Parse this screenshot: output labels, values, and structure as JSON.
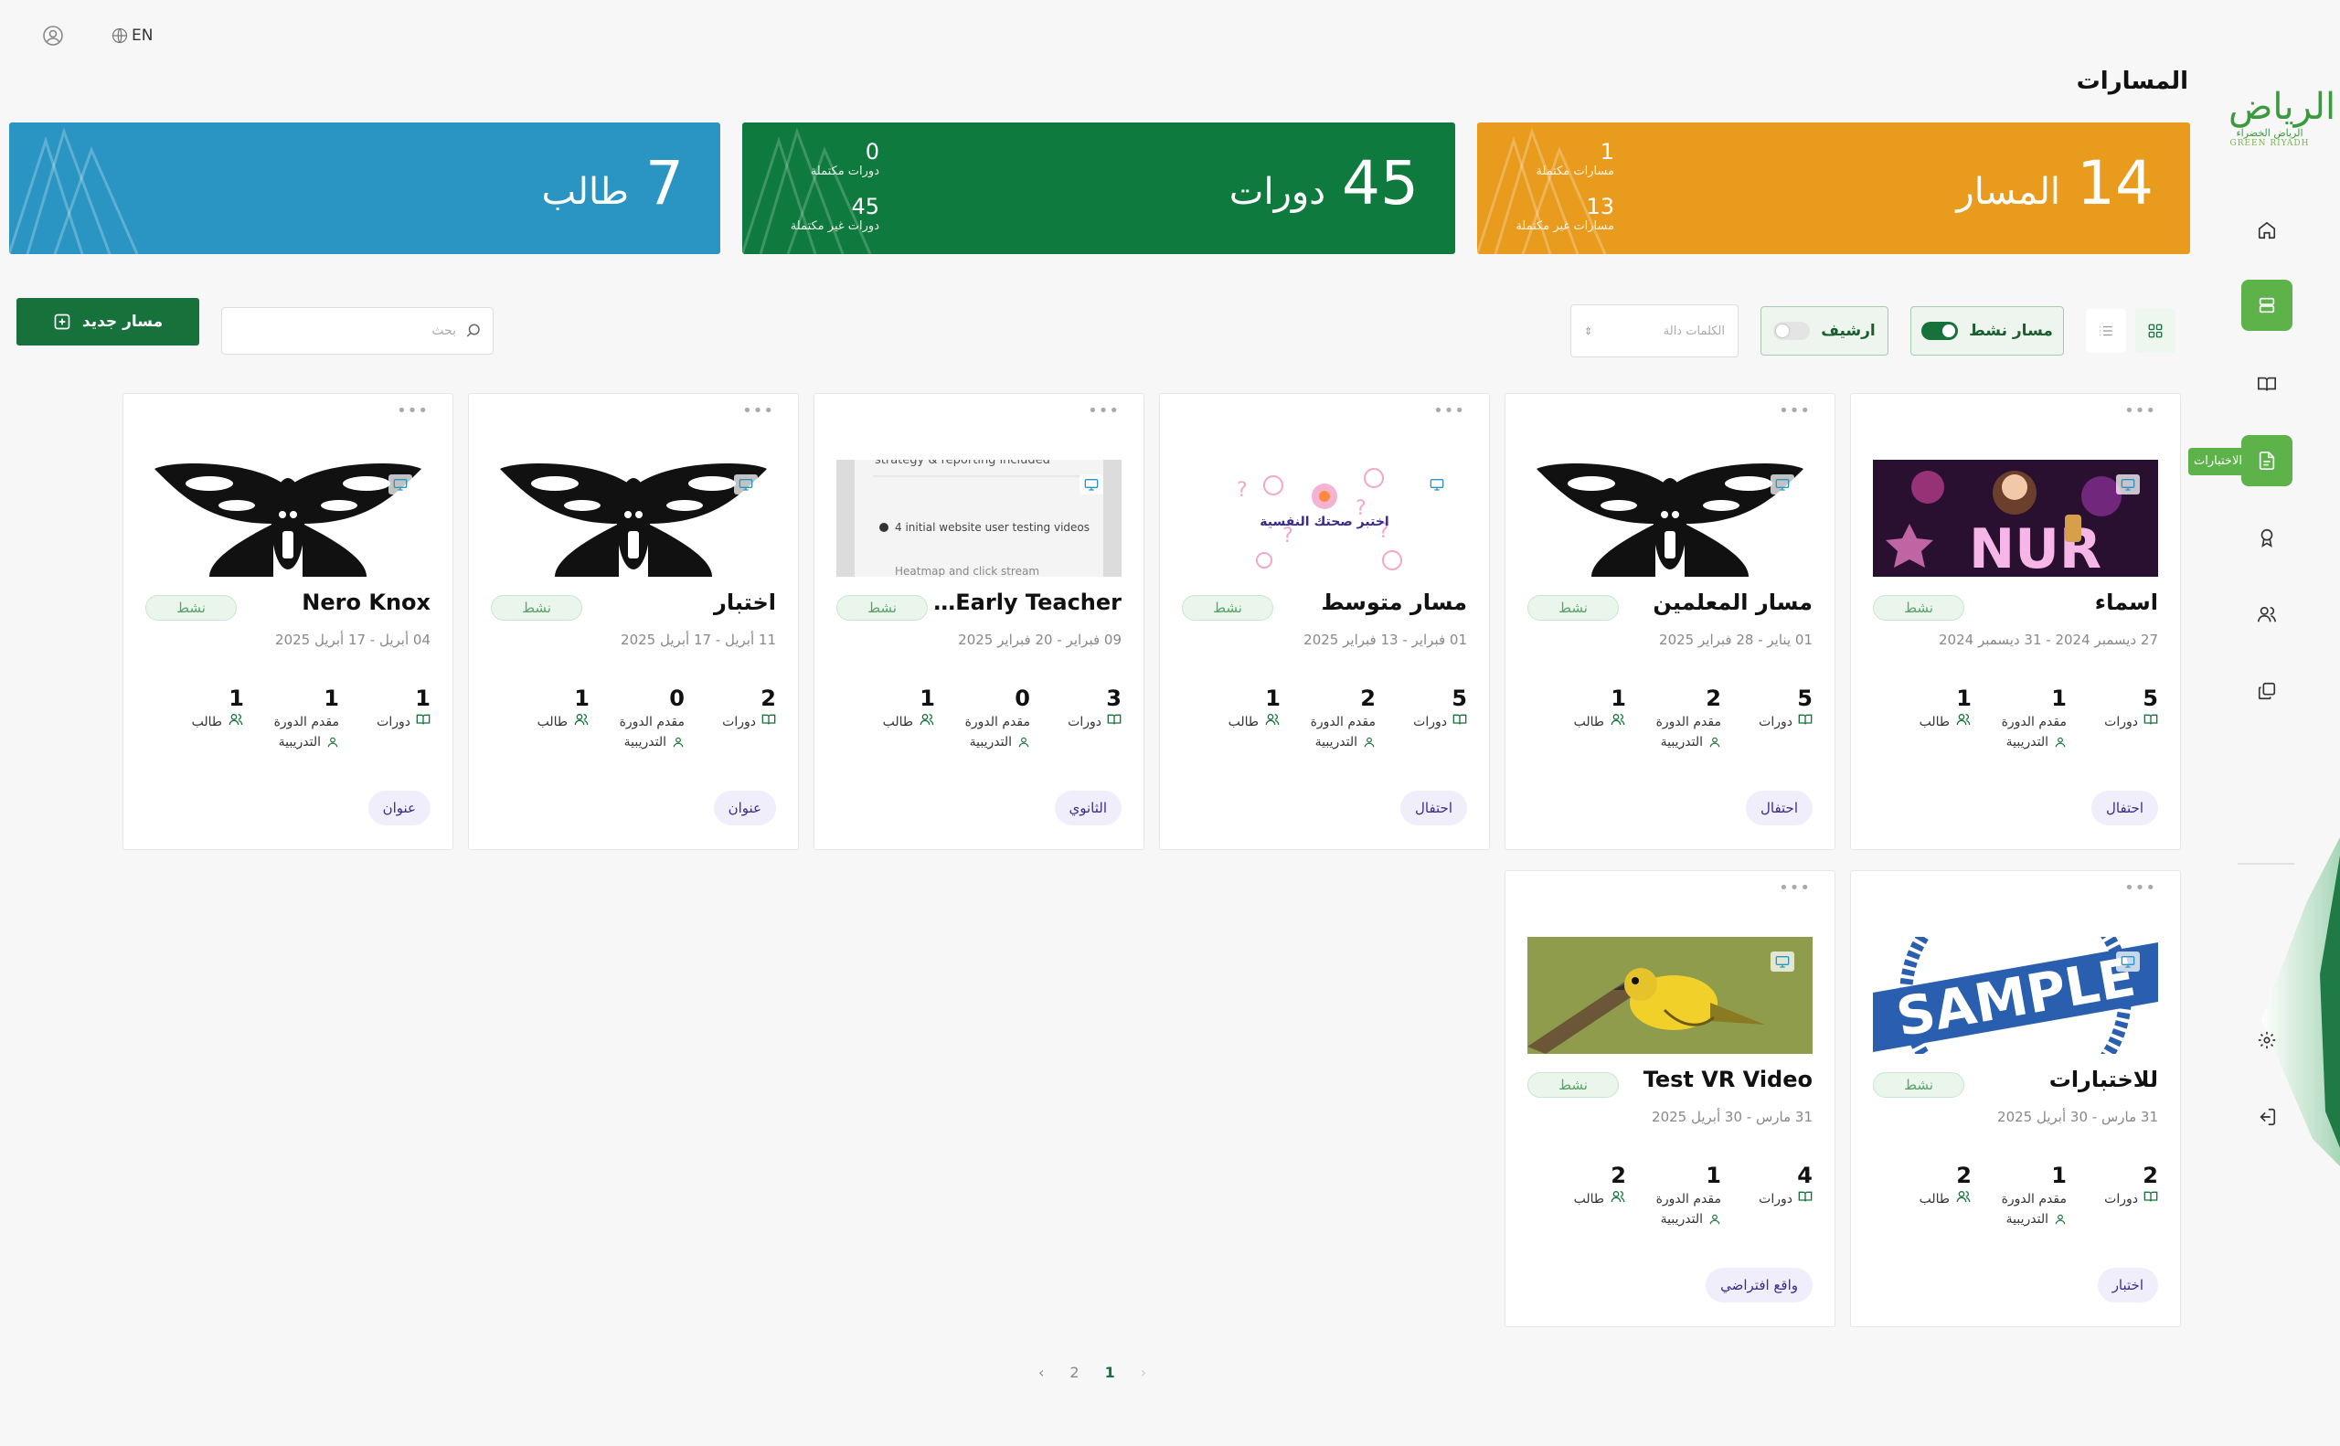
{
  "header": {
    "language": "EN"
  },
  "page": {
    "title": "المسارات"
  },
  "sidebar": {
    "tooltip": "الاختبارات"
  },
  "logo": {
    "mark": "الرياض",
    "arabic": "الرياض الخضراء",
    "english": "GREEN RIYADH"
  },
  "stats": {
    "paths": {
      "number": "14",
      "label": "المسار",
      "completed_value": "1",
      "completed_label": "مسارات مكتملة",
      "incomplete_value": "13",
      "incomplete_label": "مسارات غير مكتملة",
      "color": "#e89b1c"
    },
    "courses": {
      "number": "45",
      "label": "دورات",
      "completed_value": "0",
      "completed_label": "دورات مكتملة",
      "incomplete_value": "45",
      "incomplete_label": "دورات غير مكتملة",
      "color": "#0f7a3d"
    },
    "students": {
      "number": "7",
      "label": "طالب",
      "color": "#2a95c3"
    }
  },
  "toolbar": {
    "new_path_label": "مسار جديد",
    "search_placeholder": "بحث",
    "keywords_placeholder": "الكلمات دالة",
    "active_label": "مسار نشط",
    "archive_label": "ارشيف"
  },
  "labels": {
    "courses": "دورات",
    "instructor_line1": "مقدم الدورة",
    "instructor_line2": "التدريبية",
    "students": "طالب",
    "active": "نشط"
  },
  "cards": [
    {
      "title": "اسماء",
      "dates": "27 ديسمبر 2024 - 31 ديسمبر 2024",
      "courses": "5",
      "instructors": "1",
      "students": "1",
      "tag": "احتفال",
      "image": "neon"
    },
    {
      "title": "مسار المعلمين",
      "dates": "01 يناير - 28 فبراير 2025",
      "courses": "5",
      "instructors": "2",
      "students": "1",
      "tag": "احتفال",
      "image": "moth"
    },
    {
      "title": "مسار متوسط",
      "dates": "01 فبراير - 13 فبراير 2025",
      "courses": "5",
      "instructors": "2",
      "students": "1",
      "tag": "احتفال",
      "image": "psych",
      "image_text": "اختبر صحتك النفسية"
    },
    {
      "title": "Elementary Early Teacher",
      "dates": "09 فبراير - 20 فبراير 2025",
      "courses": "3",
      "instructors": "0",
      "students": "1",
      "tag": "الثانوي",
      "image": "doc",
      "image_text": {
        "head": "strategy & reporting included",
        "bullet1": "4 initial website user testing videos",
        "bullet2": "Heatmap and click stream"
      }
    },
    {
      "title": "اختبار",
      "dates": "11 أبريل - 17 أبريل 2025",
      "courses": "2",
      "instructors": "0",
      "students": "1",
      "tag": "عنوان",
      "image": "moth"
    },
    {
      "title": "Nero Knox",
      "dates": "04 أبريل - 17 أبريل 2025",
      "courses": "1",
      "instructors": "1",
      "students": "1",
      "tag": "عنوان",
      "image": "moth"
    },
    {
      "title": "للاختبارات",
      "dates": "31 مارس - 30 أبريل 2025",
      "courses": "2",
      "instructors": "1",
      "students": "2",
      "tag": "اختبار",
      "image": "sample",
      "image_text": "SAMPLE"
    },
    {
      "title": "Test VR Video",
      "dates": "31 مارس - 30 أبريل 2025",
      "courses": "4",
      "instructors": "1",
      "students": "2",
      "tag": "واقع افتراضي",
      "image": "bird"
    }
  ],
  "pagination": {
    "pages": [
      "2",
      "1"
    ],
    "current": "1"
  }
}
